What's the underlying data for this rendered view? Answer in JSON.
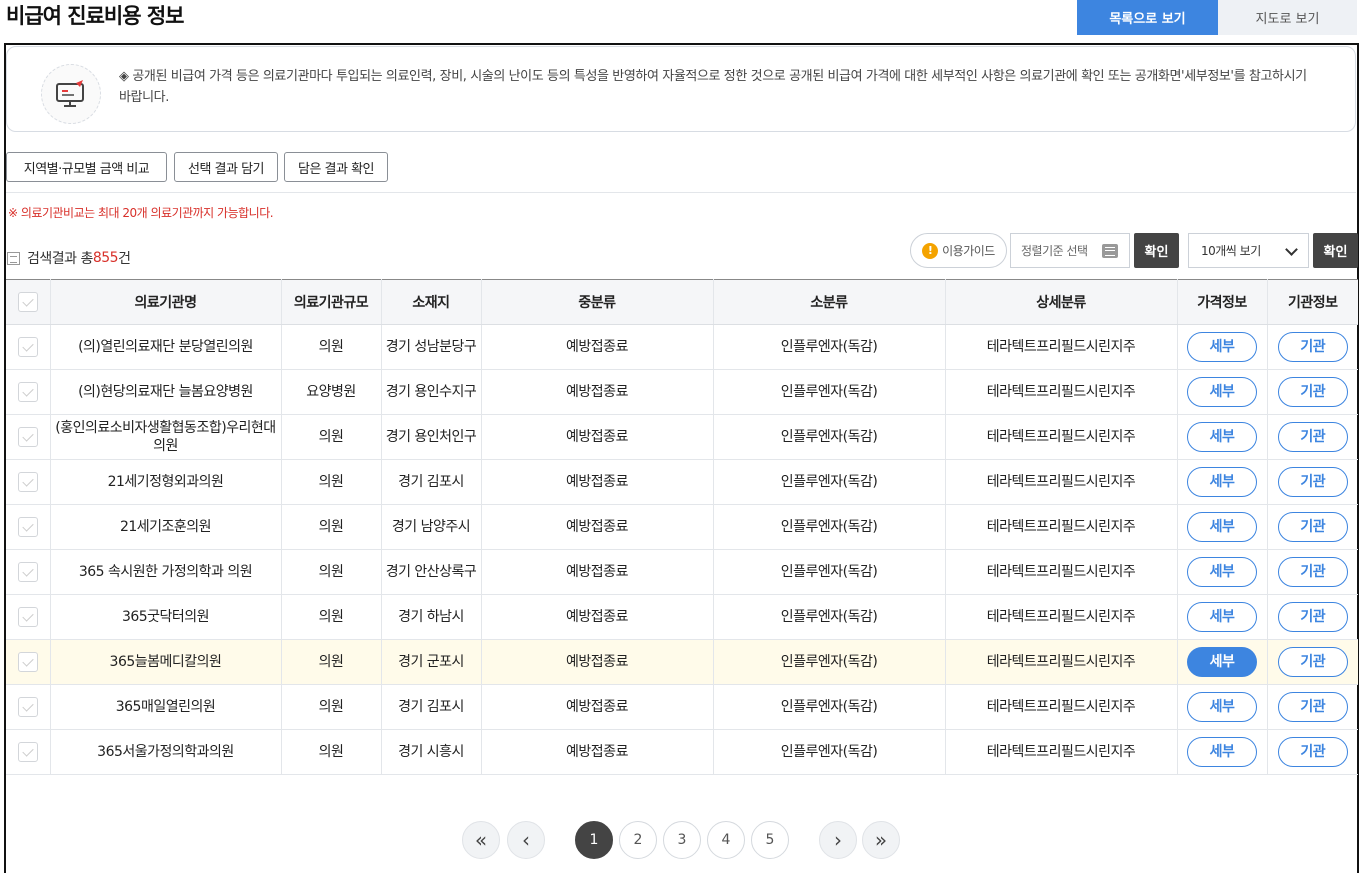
{
  "title": "비급여 진료비용 정보",
  "view_tabs": {
    "list": "목록으로 보기",
    "map": "지도로 보기"
  },
  "notice": "◈ 공개된 비급여 가격 등은 의료기관마다 투입되는 의료인력, 장비, 시술의 난이도 등의 특성을 반영하여 자율적으로 정한 것으로 공개된 비급여 가격에 대한 세부적인 사항은 의료기관에 확인 또는 공개화면'세부정보'를 참고하시기 바랍니다.",
  "actions": {
    "compare": "지역별·규모별 금액 비교",
    "save": "선택 결과 담기",
    "check": "담은 결과 확인"
  },
  "warning": "※ 의료기관비교는 최대 20개 의료기관까지 가능합니다.",
  "result": {
    "prefix": "검색결과 총 ",
    "count": "855",
    "suffix": "건"
  },
  "toolbar": {
    "guide": "이용가이드",
    "sort_placeholder": "정렬기준 선택",
    "confirm": "확인",
    "per_page": "10개씩 보기",
    "confirm2": "확인"
  },
  "table": {
    "headers": [
      "의료기관명",
      "의료기관규모",
      "소재지",
      "중분류",
      "소분류",
      "상세분류",
      "가격정보",
      "기관정보"
    ],
    "rows": [
      {
        "name": "(의)열린의료재단 분당열린의원",
        "size": "의원",
        "loc": "경기 성남분당구",
        "mid": "예방접종료",
        "sub": "인플루엔자(독감)",
        "detail": "테라텍트프리필드시린지주",
        "price": "세부",
        "info": "기관"
      },
      {
        "name": "(의)현당의료재단 늘봄요양병원",
        "size": "요양병원",
        "loc": "경기 용인수지구",
        "mid": "예방접종료",
        "sub": "인플루엔자(독감)",
        "detail": "테라텍트프리필드시린지주",
        "price": "세부",
        "info": "기관"
      },
      {
        "name": "(홍인의료소비자생활협동조합)우리현대의원",
        "size": "의원",
        "loc": "경기 용인처인구",
        "mid": "예방접종료",
        "sub": "인플루엔자(독감)",
        "detail": "테라텍트프리필드시린지주",
        "price": "세부",
        "info": "기관"
      },
      {
        "name": "21세기정형외과의원",
        "size": "의원",
        "loc": "경기 김포시",
        "mid": "예방접종료",
        "sub": "인플루엔자(독감)",
        "detail": "테라텍트프리필드시린지주",
        "price": "세부",
        "info": "기관"
      },
      {
        "name": "21세기조훈의원",
        "size": "의원",
        "loc": "경기 남양주시",
        "mid": "예방접종료",
        "sub": "인플루엔자(독감)",
        "detail": "테라텍트프리필드시린지주",
        "price": "세부",
        "info": "기관"
      },
      {
        "name": "365 속시원한 가정의학과 의원",
        "size": "의원",
        "loc": "경기 안산상록구",
        "mid": "예방접종료",
        "sub": "인플루엔자(독감)",
        "detail": "테라텍트프리필드시린지주",
        "price": "세부",
        "info": "기관"
      },
      {
        "name": "365굿닥터의원",
        "size": "의원",
        "loc": "경기 하남시",
        "mid": "예방접종료",
        "sub": "인플루엔자(독감)",
        "detail": "테라텍트프리필드시린지주",
        "price": "세부",
        "info": "기관"
      },
      {
        "name": "365늘봄메디칼의원",
        "size": "의원",
        "loc": "경기 군포시",
        "mid": "예방접종료",
        "sub": "인플루엔자(독감)",
        "detail": "테라텍트프리필드시린지주",
        "price": "세부",
        "info": "기관"
      },
      {
        "name": "365매일열린의원",
        "size": "의원",
        "loc": "경기 김포시",
        "mid": "예방접종료",
        "sub": "인플루엔자(독감)",
        "detail": "테라텍트프리필드시린지주",
        "price": "세부",
        "info": "기관"
      },
      {
        "name": "365서울가정의학과의원",
        "size": "의원",
        "loc": "경기 시흥시",
        "mid": "예방접종료",
        "sub": "인플루엔자(독감)",
        "detail": "테라텍트프리필드시린지주",
        "price": "세부",
        "info": "기관"
      }
    ]
  },
  "pagination": {
    "first": "«",
    "prev": "‹",
    "pages": [
      "1",
      "2",
      "3",
      "4",
      "5"
    ],
    "next": "›",
    "last": "»",
    "current": "1"
  },
  "colors": {
    "accent": "#3d85e0",
    "warning": "#d8302a",
    "highlight_row": "#fffbea"
  }
}
